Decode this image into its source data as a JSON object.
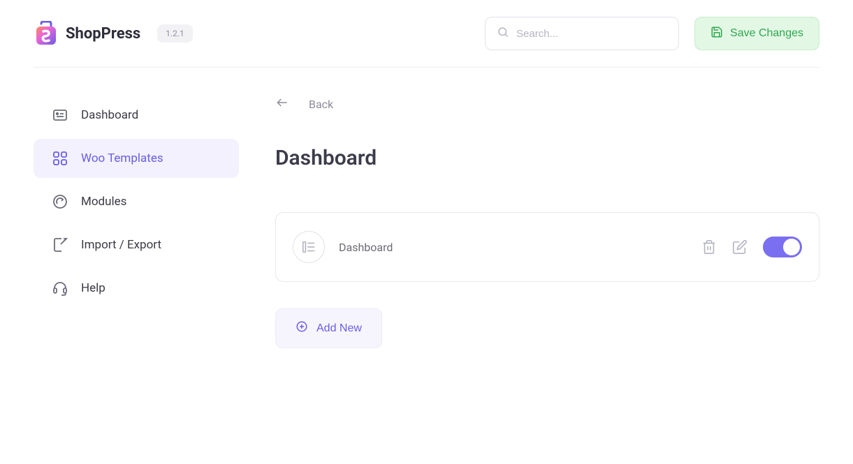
{
  "brand": {
    "name": "ShopPress",
    "version": "1.2.1"
  },
  "header": {
    "search_placeholder": "Search...",
    "save_label": "Save Changes"
  },
  "sidebar": {
    "items": [
      {
        "label": "Dashboard"
      },
      {
        "label": "Woo Templates"
      },
      {
        "label": "Modules"
      },
      {
        "label": "Import / Export"
      },
      {
        "label": "Help"
      }
    ]
  },
  "content": {
    "back_label": "Back",
    "page_title": "Dashboard",
    "template": {
      "name": "Dashboard",
      "enabled": true
    },
    "add_new_label": "Add New"
  }
}
